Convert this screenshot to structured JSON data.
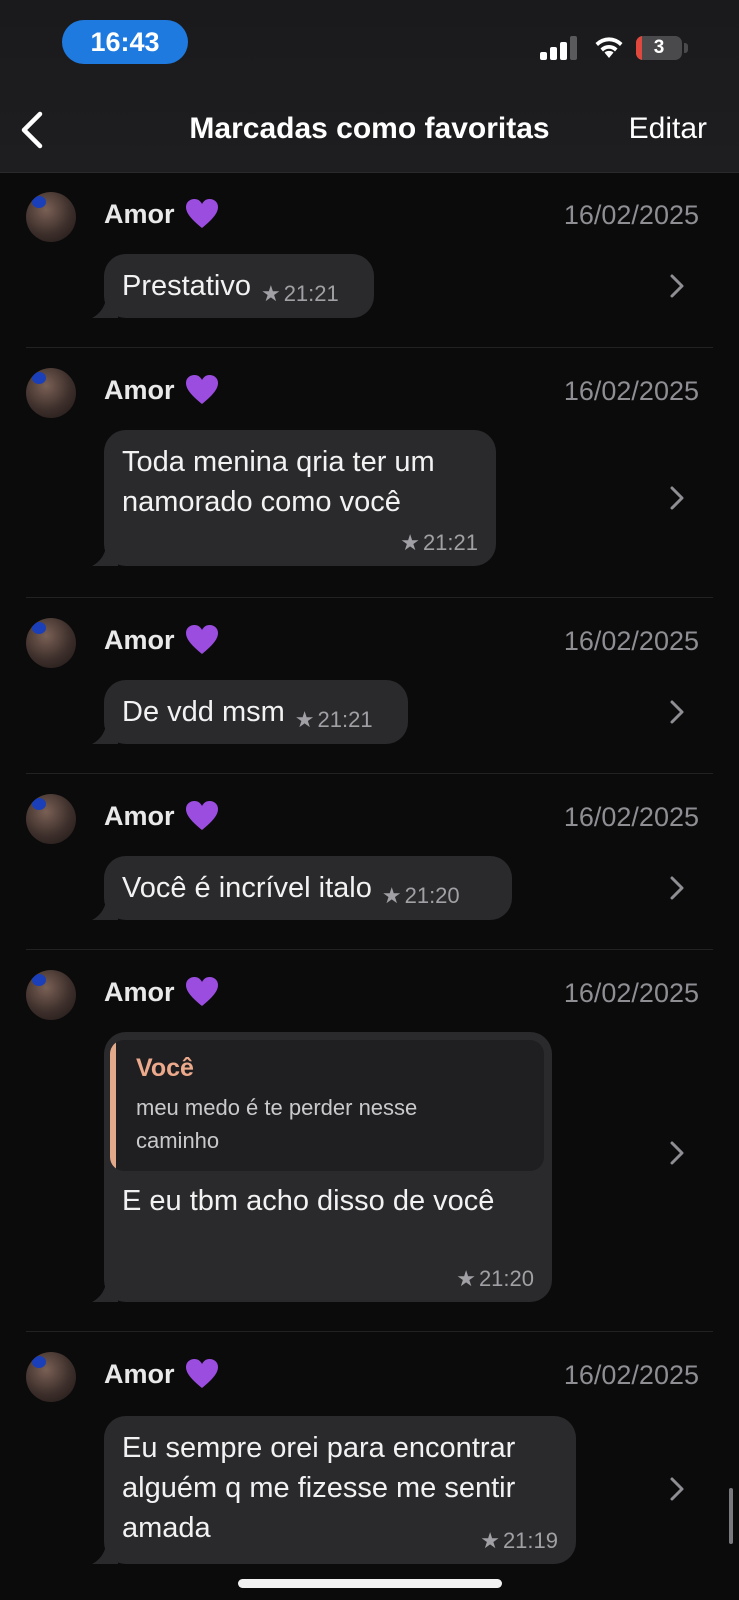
{
  "status_bar": {
    "time": "16:43",
    "battery_level": "3"
  },
  "nav": {
    "title": "Marcadas como favoritas",
    "edit_label": "Editar"
  },
  "messages": [
    {
      "sender": "Amor",
      "date": "16/02/2025",
      "text": "Prestativo",
      "time": "21:21"
    },
    {
      "sender": "Amor",
      "date": "16/02/2025",
      "text": "Toda menina qria ter um\nnamorado como você",
      "time": "21:21"
    },
    {
      "sender": "Amor",
      "date": "16/02/2025",
      "text": "De vdd msm",
      "time": "21:21"
    },
    {
      "sender": "Amor",
      "date": "16/02/2025",
      "text": "Você é incrível italo",
      "time": "21:20"
    },
    {
      "sender": "Amor",
      "date": "16/02/2025",
      "text": "E eu tbm acho disso de você",
      "time": "21:20",
      "reply": {
        "author": "Você",
        "text": "meu medo é te perder nesse\ncaminho"
      }
    },
    {
      "sender": "Amor",
      "date": "16/02/2025",
      "text": "Eu sempre orei para encontrar\nalguém q me fizesse me sentir\namada",
      "time": "21:19"
    }
  ],
  "icons": {
    "heart": "purple-heart-emoji",
    "star": "star-icon",
    "chevron": "chevron-right-icon"
  },
  "colors": {
    "accent_time_pill": "#1f7ae0",
    "heart": "#9b4de0",
    "quote_author": "#eca98c",
    "quote_bar": "#e3a98b"
  }
}
